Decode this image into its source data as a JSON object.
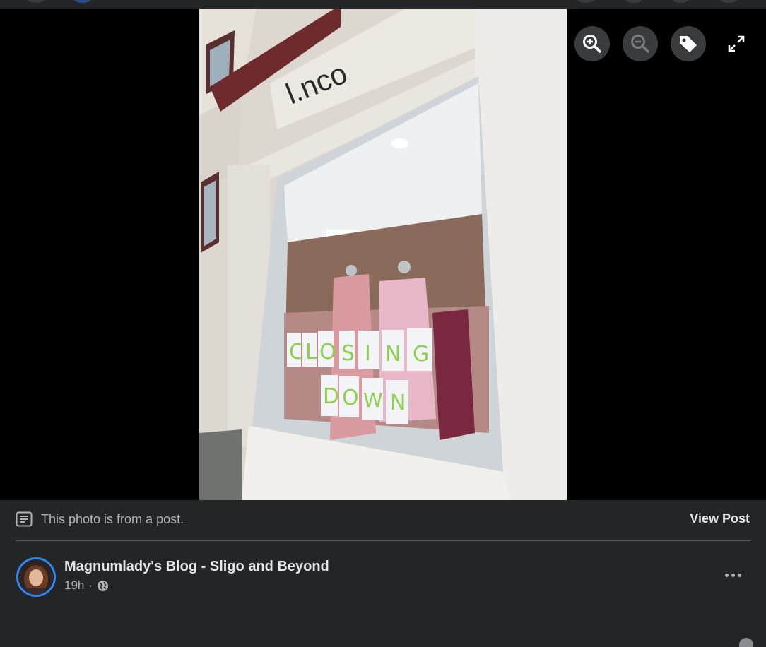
{
  "viewer": {
    "photo": {
      "shop_sign": "l.nco",
      "window_signs": [
        "C",
        "L",
        "O",
        "S",
        "I",
        "N",
        "G",
        "D",
        "O",
        "W",
        "N"
      ]
    },
    "toolbar": [
      {
        "name": "zoom-in",
        "icon": "magnifier-plus-icon"
      },
      {
        "name": "zoom-out",
        "icon": "magnifier-minus-icon"
      },
      {
        "name": "tag",
        "icon": "tag-icon"
      },
      {
        "name": "fullscreen",
        "icon": "expand-arrows-icon"
      }
    ]
  },
  "post": {
    "notice": "This photo is from a post.",
    "view_post_label": "View Post",
    "author": "Magnumlady's Blog - Sligo and Beyond",
    "time": "19h",
    "separator": "·",
    "audience_icon": "globe-icon"
  },
  "colors": {
    "panel_bg": "#242526",
    "text_primary": "#e4e6eb",
    "text_secondary": "#b0b3b8",
    "avatar_ring": "#2d88ff"
  }
}
